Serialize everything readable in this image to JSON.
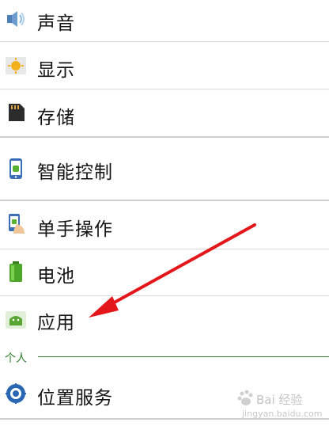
{
  "settings": {
    "items": [
      {
        "label": "声音",
        "icon": "speaker-icon"
      },
      {
        "label": "显示",
        "icon": "brightness-icon"
      },
      {
        "label": "存储",
        "icon": "sd-card-icon"
      },
      {
        "label": "智能控制",
        "icon": "phone-android-icon"
      },
      {
        "label": "单手操作",
        "icon": "hand-phone-icon"
      },
      {
        "label": "电池",
        "icon": "battery-icon"
      },
      {
        "label": "应用",
        "icon": "android-app-icon"
      },
      {
        "label": "位置服务",
        "icon": "location-icon"
      }
    ],
    "section_personal": "个人"
  },
  "watermark": {
    "text": "Bai 经验",
    "sub": "jingyan.baidu.com"
  },
  "colors": {
    "accent_green": "#2f7d2f",
    "arrow_red": "#e3161a"
  }
}
